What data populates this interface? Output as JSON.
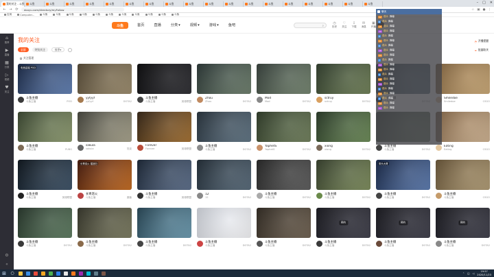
{
  "browser": {
    "tabs": [
      {
        "label": "我的关注 - 斗鱼",
        "active": true,
        "color": "#ff7a1c"
      },
      {
        "label": "斗鱼",
        "color": "#ff7a1c"
      },
      {
        "label": "斗鱼",
        "color": "#ff7a1c"
      },
      {
        "label": "斗鱼",
        "color": "#ff7a1c"
      },
      {
        "label": "斗鱼",
        "color": "#ff7a1c"
      },
      {
        "label": "斗鱼",
        "color": "#ff7a1c"
      },
      {
        "label": "斗鱼",
        "color": "#ff7a1c"
      },
      {
        "label": "斗鱼",
        "color": "#ff7a1c"
      },
      {
        "label": "斗鱼",
        "color": "#ff7a1c"
      },
      {
        "label": "斗鱼",
        "color": "#ff7a1c"
      },
      {
        "label": "斗鱼",
        "color": "#ff7a1c"
      },
      {
        "label": "斗鱼",
        "color": "#ff7a1c"
      },
      {
        "label": "斗鱼",
        "color": "#ff7a1c"
      },
      {
        "label": "斗鱼",
        "color": "#ff7a1c"
      },
      {
        "label": "斗鱼",
        "color": "#ff7a1c"
      },
      {
        "label": "斗鱼",
        "color": "#ff7a1c"
      },
      {
        "label": "斗鱼",
        "color": "#ff7a1c"
      },
      {
        "label": "斗鱼",
        "color": "#ff7a1c"
      },
      {
        "label": "斗鱼",
        "color": "#ff7a1c"
      }
    ],
    "url": "douyu.com/directory/myFollow",
    "bookmarks": [
      "应用",
      "Computer...",
      "斗鱼",
      "斗鱼",
      "斗鱼",
      "斗鱼",
      "斗鱼",
      "斗鱼",
      "斗鱼",
      "斗鱼",
      "斗鱼",
      "斗鱼",
      "斗鱼"
    ]
  },
  "header": {
    "logo": "斗鱼",
    "nav": [
      {
        "label": "首页",
        "on": false
      },
      {
        "label": "直播",
        "on": false
      },
      {
        "label": "分类",
        "on": false,
        "dropdown": true
      },
      {
        "label": "视频",
        "on": false,
        "dropdown": true
      },
      {
        "label": "游戏",
        "on": false,
        "dropdown": true
      },
      {
        "label": "鱼吧",
        "on": false
      }
    ],
    "icons": [
      {
        "label": "历史",
        "icon": "clock-icon",
        "glyph": "◷"
      },
      {
        "label": "关注",
        "icon": "heart-icon",
        "glyph": "♡"
      },
      {
        "label": "下载",
        "icon": "download-icon",
        "glyph": "⇩"
      },
      {
        "label": "消息",
        "icon": "message-icon",
        "glyph": "✉"
      },
      {
        "label": "开播",
        "icon": "camera-icon",
        "glyph": "▣"
      }
    ]
  },
  "sidebar": {
    "items": [
      {
        "label": "推荐",
        "icon": "home-icon",
        "glyph": "⌂"
      },
      {
        "label": "直播",
        "icon": "live-icon",
        "glyph": "▶"
      },
      {
        "label": "分类",
        "icon": "grid-icon",
        "glyph": "▦"
      },
      {
        "label": "视频",
        "icon": "video-icon",
        "glyph": "▷"
      },
      {
        "label": "关注",
        "icon": "heart-icon",
        "glyph": "♥"
      }
    ],
    "bottom": [
      {
        "icon": "settings-icon",
        "glyph": "⚙"
      },
      {
        "icon": "collapse-icon",
        "glyph": "«"
      }
    ]
  },
  "main": {
    "title": "我的关注",
    "filters": [
      {
        "label": "全部",
        "on": true
      },
      {
        "label": "特别关注",
        "on": false
      }
    ],
    "sort_label": "排序",
    "manage_label": "关注管理",
    "right_actions": [
      {
        "label": "开播提醒"
      },
      {
        "label": "批量取关"
      }
    ]
  },
  "cards": [
    {
      "title": "斗鱼主播",
      "streamer": "斗鱼主播",
      "cat": "POD",
      "c1": "#1d2c4a",
      "c2": "#5f7fb4",
      "av": "#3a3a3a",
      "ov": "电竞高端 POD"
    },
    {
      "title": "yyfyyf",
      "streamer": "yyfyyf",
      "cat": "DOTA2",
      "c1": "#5a4e3a",
      "c2": "#9a8a6a",
      "av": "#a57a4f"
    },
    {
      "title": "斗鱼主播",
      "streamer": "斗鱼主播",
      "cat": "英雄联盟",
      "c1": "#0e0e10",
      "c2": "#2b2b30",
      "av": "#444"
    },
    {
      "title": "Zhou",
      "streamer": "Zhou",
      "cat": "DOTA2",
      "c1": "#2f3b3a",
      "c2": "#6b7d6a",
      "av": "#c08a60"
    },
    {
      "title": "Mod",
      "streamer": "Mod",
      "cat": "DOTA2",
      "c1": "#3b4540",
      "c2": "#72836d",
      "av": "#888"
    },
    {
      "title": "sctruy",
      "streamer": "sctruy",
      "cat": "DOTA2",
      "c1": "#354231",
      "c2": "#6e7f55",
      "av": "#d9a060"
    },
    {
      "title": "斗鱼主播",
      "streamer": "斗鱼主播",
      "cat": "DOTA2",
      "c1": "#2c3a42",
      "c2": "#64808e",
      "av": "#222"
    },
    {
      "title": "Smiledoe",
      "streamer": "Smiledoe",
      "cat": "CSGO",
      "c1": "#8a6a43",
      "c2": "#c9a774",
      "av": "#e4c39a"
    },
    {
      "title": "斗鱼主播",
      "streamer": "斗鱼主播",
      "cat": "PUBG",
      "c1": "#3e4b34",
      "c2": "#8e9c6f",
      "av": "#7d6a55"
    },
    {
      "title": "sakula",
      "streamer": "sakula",
      "cat": "坦克",
      "c1": "#4a4a42",
      "c2": "#a7a28a",
      "av": "#666"
    },
    {
      "title": "Forever",
      "streamer": "Forever",
      "cat": "英雄联盟",
      "c1": "#3a2a1a",
      "c2": "#a46f2e",
      "av": "#b94d3a"
    },
    {
      "title": "斗鱼主播",
      "streamer": "斗鱼主播",
      "cat": "DOTA2",
      "c1": "#2b3640",
      "c2": "#5d7282",
      "av": "#8b8b8b"
    },
    {
      "title": "YaphetS",
      "streamer": "YaphetS",
      "cat": "DOTA2",
      "c1": "#33402c",
      "c2": "#6f7f5a",
      "av": "#c9926a"
    },
    {
      "title": "xiong",
      "streamer": "xiong",
      "cat": "DOTA2",
      "c1": "#2e3f2c",
      "c2": "#6a8a55",
      "av": "#7a6a5a"
    },
    {
      "title": "斗鱼主播",
      "streamer": "斗鱼主播",
      "cat": "DOTA2",
      "c1": "#324034",
      "c2": "#7a8d71",
      "av": "#444"
    },
    {
      "title": "Eating",
      "streamer": "Eating",
      "cat": "CSGO",
      "c1": "#8a6b4b",
      "c2": "#cdb18f",
      "av": "#e5c8a0"
    },
    {
      "title": "斗鱼主播",
      "streamer": "斗鱼主播",
      "cat": "英雄联盟",
      "c1": "#101820",
      "c2": "#3a5066",
      "av": "#222"
    },
    {
      "title": "长青巡火",
      "streamer": "斗鱼主播",
      "cat": "魔兽",
      "c1": "#4a1d10",
      "c2": "#c66a1d",
      "av": "#b44",
      "ov": "长青巡火 插回归"
    },
    {
      "title": "斗鱼主播",
      "streamer": "斗鱼主播",
      "cat": "英雄联盟",
      "c1": "#1e2a3a",
      "c2": "#5a6d8a",
      "av": "#333"
    },
    {
      "title": "12",
      "streamer": "12",
      "cat": "DOTA2",
      "c1": "#25303a",
      "c2": "#556878",
      "av": "#888"
    },
    {
      "title": "斗鱼主播",
      "streamer": "斗鱼主播",
      "cat": "DOTA2",
      "c1": "#2a2a2a",
      "c2": "#5a5a5a",
      "av": "#aaa"
    },
    {
      "title": "斗鱼主播",
      "streamer": "斗鱼主播",
      "cat": "DOTA2",
      "c1": "#3a4430",
      "c2": "#7c8c5a",
      "av": "#6a8a4a"
    },
    {
      "title": "斗鱼主播",
      "streamer": "斗鱼主播",
      "cat": "DOTA2",
      "c1": "#1a2a4a",
      "c2": "#5a7ab0",
      "av": "#444",
      "ov": "带头大哥"
    },
    {
      "title": "斗鱼主播",
      "streamer": "斗鱼主播",
      "cat": "CSGO",
      "c1": "#6e5a3c",
      "c2": "#b09b73",
      "av": "#c59b6a"
    },
    {
      "title": "斗鱼主播",
      "streamer": "斗鱼主播",
      "cat": "DOTA2",
      "c1": "#2a3a2e",
      "c2": "#5b7a5e",
      "av": "#3a3a3a"
    },
    {
      "title": "斗鱼主播",
      "streamer": "斗鱼主播",
      "cat": "DOTA2",
      "c1": "#3a3a2e",
      "c2": "#7a7a5e",
      "av": "#8a6a4a"
    },
    {
      "title": "斗鱼主播",
      "streamer": "斗鱼主播",
      "cat": "DOTA2",
      "c1": "#2a4a5a",
      "c2": "#6a9ab0",
      "av": "#444"
    },
    {
      "title": "斗鱼主播",
      "streamer": "斗鱼主播",
      "cat": "DOTA2",
      "c1": "#d9dde5",
      "c2": "#f5f5f7",
      "av": "#c44"
    },
    {
      "title": "斗鱼主播",
      "streamer": "斗鱼主播",
      "cat": "DOTA2",
      "c1": "#352e26",
      "c2": "#6e604f",
      "av": "#555"
    },
    {
      "title": "斗鱼主播",
      "streamer": "斗鱼主播",
      "cat": "DOTA2",
      "c1": "#1c1c22",
      "c2": "#3c3c48",
      "av": "#3a3a3a",
      "play": "预约"
    },
    {
      "title": "斗鱼主播",
      "streamer": "斗鱼主播",
      "cat": "DOTA2",
      "c1": "#1c1c22",
      "c2": "#3c3c48",
      "av": "#6a4a3a",
      "play": "预约"
    },
    {
      "title": "斗鱼主播",
      "streamer": "斗鱼主播",
      "cat": "DOTA2",
      "c1": "#1c1c22",
      "c2": "#3c3c48",
      "av": "#888",
      "play": "预约"
    }
  ],
  "chat": {
    "title": "聊天",
    "lines": [
      {
        "lv": "12",
        "cls": "",
        "name": "观众",
        "msg": "弹幕"
      },
      {
        "lv": "8",
        "cls": "b",
        "name": "观众",
        "msg": "弹幕"
      },
      {
        "lv": "15",
        "cls": "",
        "name": "观众",
        "msg": "弹幕"
      },
      {
        "lv": "20",
        "cls": "p",
        "name": "观众",
        "msg": "弹幕"
      },
      {
        "lv": "9",
        "cls": "b",
        "name": "观众",
        "msg": "弹幕"
      },
      {
        "lv": "11",
        "cls": "",
        "name": "观众",
        "msg": "弹幕"
      },
      {
        "lv": "6",
        "cls": "b",
        "name": "观众",
        "msg": "弹幕"
      },
      {
        "lv": "18",
        "cls": "p",
        "name": "观众",
        "msg": "弹幕"
      },
      {
        "lv": "13",
        "cls": "",
        "name": "观众",
        "msg": "弹幕"
      },
      {
        "lv": "7",
        "cls": "b",
        "name": "观众",
        "msg": "弹幕"
      },
      {
        "lv": "22",
        "cls": "p",
        "name": "观众",
        "msg": "弹幕"
      },
      {
        "lv": "10",
        "cls": "",
        "name": "观众",
        "msg": "弹幕"
      },
      {
        "lv": "5",
        "cls": "b",
        "name": "观众",
        "msg": "弹幕"
      },
      {
        "lv": "16",
        "cls": "",
        "name": "观众",
        "msg": "弹幕"
      },
      {
        "lv": "14",
        "cls": "p",
        "name": "观众",
        "msg": "弹幕"
      },
      {
        "lv": "9",
        "cls": "b",
        "name": "观众",
        "msg": "弹幕"
      },
      {
        "lv": "19",
        "cls": "",
        "name": "观众",
        "msg": "弹幕"
      },
      {
        "lv": "4",
        "cls": "b",
        "name": "观众",
        "msg": "弹幕"
      },
      {
        "lv": "12",
        "cls": "",
        "name": "观众",
        "msg": "弹幕"
      },
      {
        "lv": "17",
        "cls": "p",
        "name": "观众",
        "msg": "弹幕"
      }
    ]
  },
  "taskbar": {
    "apps": [
      "#f5c542",
      "#3a8ee6",
      "#e84b3c",
      "#f5a623",
      "#4caf50",
      "#2b7de9",
      "#e6e6e6",
      "#ff7a1c",
      "#9c27b0",
      "#00bcd4",
      "#607d8b",
      "#795548"
    ],
    "time": "19:57",
    "date": "2020/11/23"
  }
}
